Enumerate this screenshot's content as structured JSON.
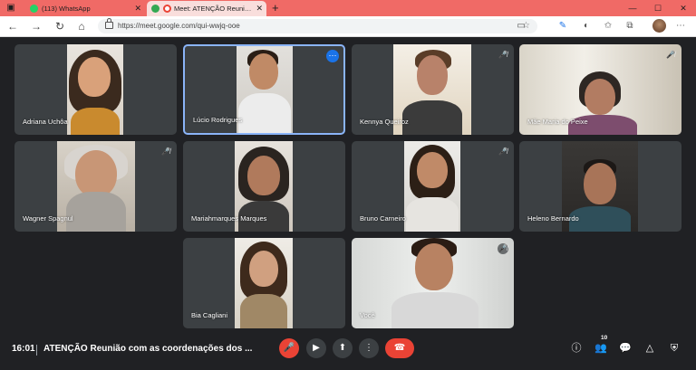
{
  "browser": {
    "tabs": [
      {
        "label": "(113) WhatsApp",
        "favicon_color": "#25d366"
      },
      {
        "label": "Meet: ATENÇÃO Reunião co",
        "favicon_color": "#ea4335"
      }
    ],
    "url": "https://meet.google.com/qui-wwjq-ooe"
  },
  "participants": [
    {
      "name": "Adriana Uchôa",
      "muted": false
    },
    {
      "name": "Lúcio Rodrigues",
      "muted": false
    },
    {
      "name": "Kennya Queiroz",
      "muted": true
    },
    {
      "name": "Mãe Maria do Peixe",
      "muted": true
    },
    {
      "name": "Wagner Spagnul",
      "muted": true
    },
    {
      "name": "Mariahmarques Marques",
      "muted": false
    },
    {
      "name": "Bruno Carneiro",
      "muted": true
    },
    {
      "name": "Heleno Bernardo",
      "muted": false
    },
    {
      "name": "Bia Cagliani",
      "muted": false
    },
    {
      "name": "Você",
      "muted": true
    }
  ],
  "bottom_bar": {
    "time": "16:01",
    "meeting_title": "ATENÇÃO Reunião com as coordenações dos ...",
    "participant_count": "10"
  },
  "colors": {
    "titlebar": "#f06a66",
    "meet_bg": "#202124",
    "tile_bg": "#3c4043",
    "active_speaker": "#8ab4f8",
    "end_call": "#ea4335"
  }
}
